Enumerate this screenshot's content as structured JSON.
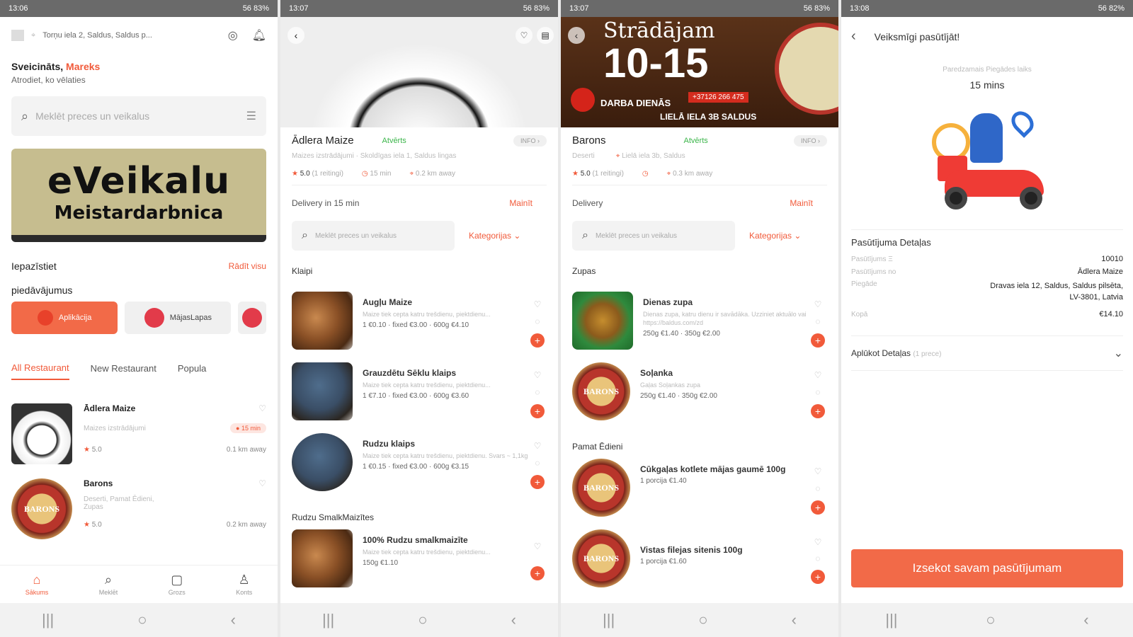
{
  "screen1": {
    "time": "13:06",
    "status_right": "56 83%",
    "address": "Torņu iela 2, Saldus, Saldus p...",
    "greeting": "Sveicināts,",
    "user_name": "Mareks",
    "subtitle": "Atrodiet, ko vēlaties",
    "search_placeholder": "Meklēt preces un veikalus",
    "banner_line1": "eVeikalu",
    "banner_line2": "Meistardarbnica",
    "featured_label": "Iepazīstiet",
    "see_all": "Rādīt visu",
    "offers_label": "piedāvājumus",
    "chips": [
      "Aplikācija",
      "MājasLapas"
    ],
    "tabs": [
      "All Restaurant",
      "New Restaurant",
      "Popula"
    ],
    "restaurants": [
      {
        "name": "Ādlera Maize",
        "desc": "Maizes izstrādājumi",
        "rating": "5.0",
        "eta": "15 min",
        "distance": "0.1 km away"
      },
      {
        "name": "Barons",
        "desc": "Deserti, Pamat Ēdieni, Zupas",
        "rating": "5.0",
        "distance": "0.2 km away"
      }
    ],
    "bottom_nav": [
      "Sākums",
      "Meklēt",
      "Grozs",
      "Konts"
    ]
  },
  "screen2": {
    "time": "13:07",
    "status_right": "56 83%",
    "name": "Ādlera Maize",
    "open": "Atvērts",
    "info": "INFO",
    "desc": "Maizes izstrādājumi · Skoldīgas iela 1, Saldus lingas",
    "rating": "5.0",
    "ratings_count": "(1 reitingi)",
    "eta": "15 min",
    "distance": "0.2 km away",
    "delivery": "Delivery in 15 min",
    "change": "Mainīt",
    "search_placeholder": "Meklēt preces un veikalus",
    "categories": "Kategorijas",
    "section1": "Klaipi",
    "section2": "Rudzu SmalkMaizītes",
    "items": [
      {
        "title": "Augļu Maize",
        "desc": "Maize tiek cepta katru trešdienu, piektdienu...",
        "price": "1 €0.10 · fixed €3.00 · 600g €4.10"
      },
      {
        "title": "Grauzdētu Sēklu klaips",
        "desc": "Maize tiek cepta katru trešdienu, piektdienu...",
        "price": "1 €7.10 · fixed €3.00 · 600g €3.60"
      },
      {
        "title": "Rudzu klaips",
        "desc": "Maize tiek cepta katru trešdienu, piektdienu. Svars ~ 1,1kg",
        "price": "1 €0.15 · fixed €3.00 · 600g €3.15"
      },
      {
        "title": "100% Rudzu smalkmaizīte",
        "desc": "Maize tiek cepta katru trešdienu, piektdienu...",
        "price": "150g €1.10"
      }
    ]
  },
  "screen3": {
    "time": "13:07",
    "status_right": "56 83%",
    "banner_top": "Strādājam",
    "banner_hours": "10-15",
    "banner_days": "DARBA DIENĀS",
    "banner_phone": "+37126 266 475",
    "banner_addr": "LIELĀ IELA 3B SALDUS",
    "name": "Barons",
    "open": "Atvērts",
    "info": "INFO",
    "category": "Deserti",
    "address": "Lielā iela 3b, Saldus",
    "rating": "5.0",
    "ratings_count": "(1 reitingi)",
    "distance": "0.3 km away",
    "delivery": "Delivery",
    "change": "Mainīt",
    "search_placeholder": "Meklēt preces un veikalus",
    "categories": "Kategorijas",
    "section1": "Zupas",
    "section2": "Pamat Ēdieni",
    "items": [
      {
        "title": "Dienas zupa",
        "desc": "Dienas zupa, katru dienu ir savādāka. Uzziniet aktuālo vai https://baldus.com/zd",
        "price": "250g €1.40 · 350g €2.00"
      },
      {
        "title": "Soļanka",
        "desc": "Gaļas Soļankas zupa",
        "price": "250g €1.40 · 350g €2.00"
      },
      {
        "title": "Cūkgaļas kotlete mājas gaumē 100g",
        "desc": "",
        "price": "1 porcija €1.40"
      },
      {
        "title": "Vistas filejas sitenis 100g",
        "desc": "",
        "price": "1 porcija €1.60"
      }
    ]
  },
  "screen4": {
    "time": "13:08",
    "status_right": "56 82%",
    "title": "Veiksmīgi pasūtījāt!",
    "eta_label": "Paredzamais Piegādes laiks",
    "eta_value": "15 mins",
    "details_title": "Pasūtījuma Detaļas",
    "rows": [
      {
        "label": "Pasūtījums Ξ",
        "value": "10010"
      },
      {
        "label": "Pasūtījums no",
        "value": "Ādlera Maize"
      },
      {
        "label": "Piegāde",
        "value": "Dravas iela 12, Saldus, Saldus pilsēta, LV-3801, Latvia"
      },
      {
        "label": "Kopā",
        "value": "€14.10"
      }
    ],
    "items_title": "Aplūkot Detaļas",
    "items_count": "(1 prece)",
    "track_button": "Izsekot savam pasūtījumam"
  },
  "colors": {
    "accent": "#f15a3a",
    "open": "#3bb54a"
  }
}
